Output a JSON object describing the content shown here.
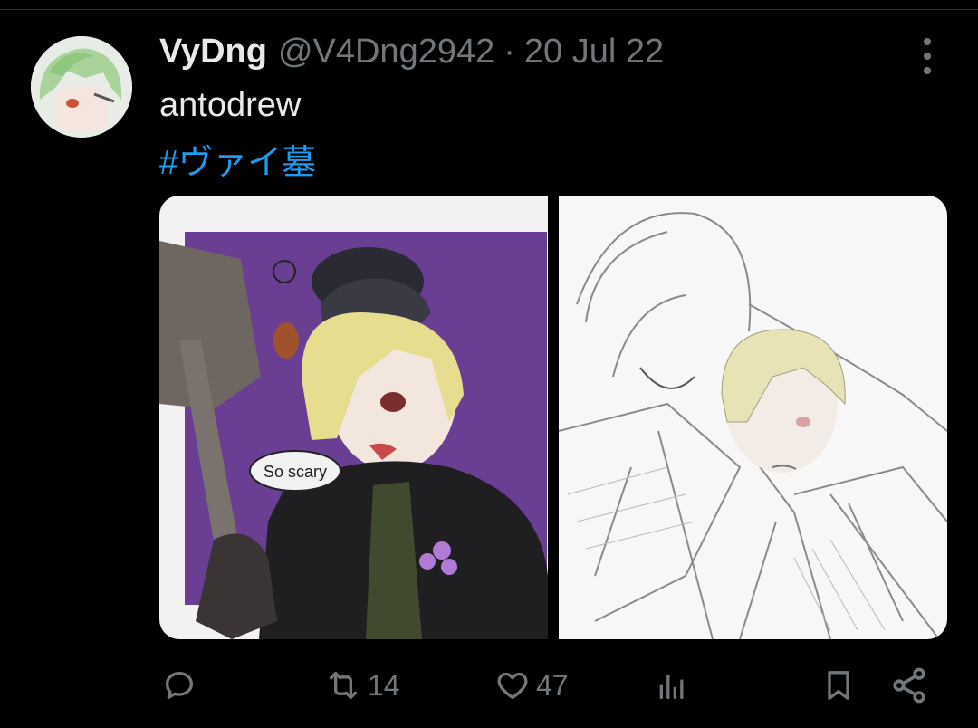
{
  "tweet": {
    "author_name": "VyDng",
    "author_handle": "@V4Dng2942",
    "separator": "·",
    "date": "20 Jul 22",
    "text": "antodrew",
    "hashtag": "#ヴァイ墓"
  },
  "media": [
    {
      "icon": "illustration-image",
      "speech_bubble": "So scary"
    },
    {
      "icon": "sketch-image"
    }
  ],
  "actions": {
    "reply": {
      "icon": "reply-icon",
      "count": ""
    },
    "retweet": {
      "icon": "retweet-icon",
      "count": "14"
    },
    "like": {
      "icon": "heart-icon",
      "count": "47"
    },
    "views": {
      "icon": "analytics-icon",
      "count": ""
    },
    "bookmark": {
      "icon": "bookmark-icon"
    },
    "share": {
      "icon": "share-icon"
    }
  },
  "colors": {
    "background": "#000000",
    "text": "#e7e9ea",
    "secondary": "#71767b",
    "link": "#1d9bf0",
    "purple_bg": "#6a3f93"
  }
}
